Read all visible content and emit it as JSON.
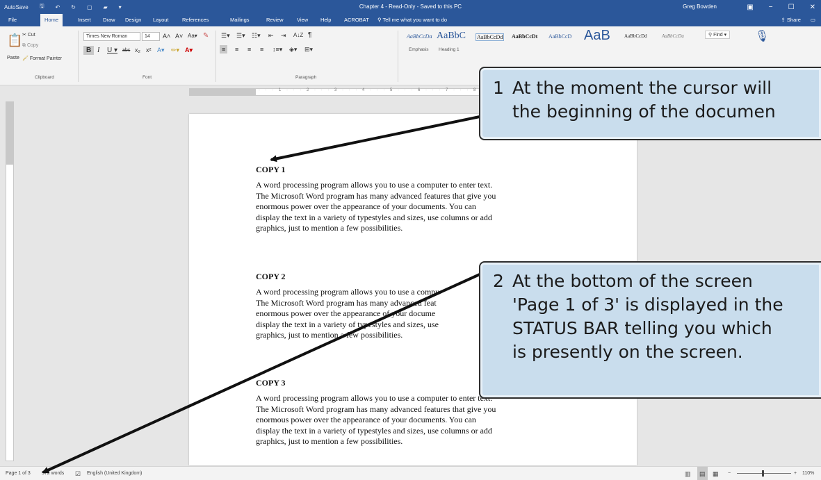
{
  "window": {
    "title": "Chapter 4  -  Read-Only  -  Saved to this PC",
    "user": "Greg Bowden",
    "autosave": "AutoSave",
    "controls": [
      "−",
      "☐",
      "✕"
    ]
  },
  "tabs": [
    "File",
    "Home",
    "Insert",
    "Draw",
    "Design",
    "Layout",
    "References",
    "Mailings",
    "Review",
    "View",
    "Help",
    "ACROBAT"
  ],
  "tell_me": "Tell me what you want to do",
  "share": "Share",
  "ribbon": {
    "clipboard": {
      "paste": "Paste",
      "cut": "Cut",
      "copy": "Copy",
      "format_painter": "Format Painter",
      "label": "Clipboard"
    },
    "font": {
      "name": "Times New Roman",
      "size": "14",
      "label": "Font"
    },
    "paragraph": {
      "label": "Paragraph"
    },
    "styles": [
      {
        "sample": "AaBbCcDa",
        "name": "Emphasis"
      },
      {
        "sample": "AaBbC",
        "name": "Heading 1"
      },
      {
        "sample": "AaBbCcDd",
        "name": ""
      },
      {
        "sample": "AaBbCcDt",
        "name": ""
      },
      {
        "sample": "AaBbCcD",
        "name": ""
      },
      {
        "sample": "AaB",
        "name": ""
      },
      {
        "sample": "AaBbCcDd",
        "name": ""
      },
      {
        "sample": "AaBbCcDa",
        "name": ""
      }
    ],
    "find": "Find"
  },
  "document": {
    "copies": [
      {
        "heading": "COPY 1",
        "lines": [
          "A word processing program allows you to use a computer to enter text.",
          "The Microsoft Word program has many advanced features that give you",
          "enormous power over the appearance of your documents.  You can",
          "display the text in a variety of typestyles and sizes, use columns or add",
          "graphics, just to mention a few possibilities."
        ]
      },
      {
        "heading": "COPY 2",
        "lines": [
          "A word processing program allows you to use a compu",
          "The Microsoft Word program has many advanced feat",
          "enormous power over the appearance of your docume",
          "display the text in a variety of typestyles and sizes, use",
          "graphics, just to mention a few possibilities."
        ]
      },
      {
        "heading": "COPY 3",
        "lines": [
          "A word processing program allows you to use a computer to enter text.",
          "The Microsoft Word program has many advanced features that give you",
          "enormous power over the appearance of your documents.  You can",
          "display the text in a variety of typestyles and sizes, use columns or add",
          "graphics, just to mention a few possibilities."
        ]
      }
    ]
  },
  "statusbar": {
    "page": "Page 1 of 3",
    "words": "572 words",
    "language": "English (United Kingdom)",
    "zoom": "110%"
  },
  "callouts": [
    {
      "number": "1",
      "lines": [
        "At the moment the cursor will",
        "the beginning of the documen"
      ]
    },
    {
      "number": "2",
      "lines": [
        "At the bottom of the screen",
        "'Page 1 of 3' is displayed in the",
        "STATUS BAR telling you which",
        "is presently on the screen."
      ]
    }
  ]
}
